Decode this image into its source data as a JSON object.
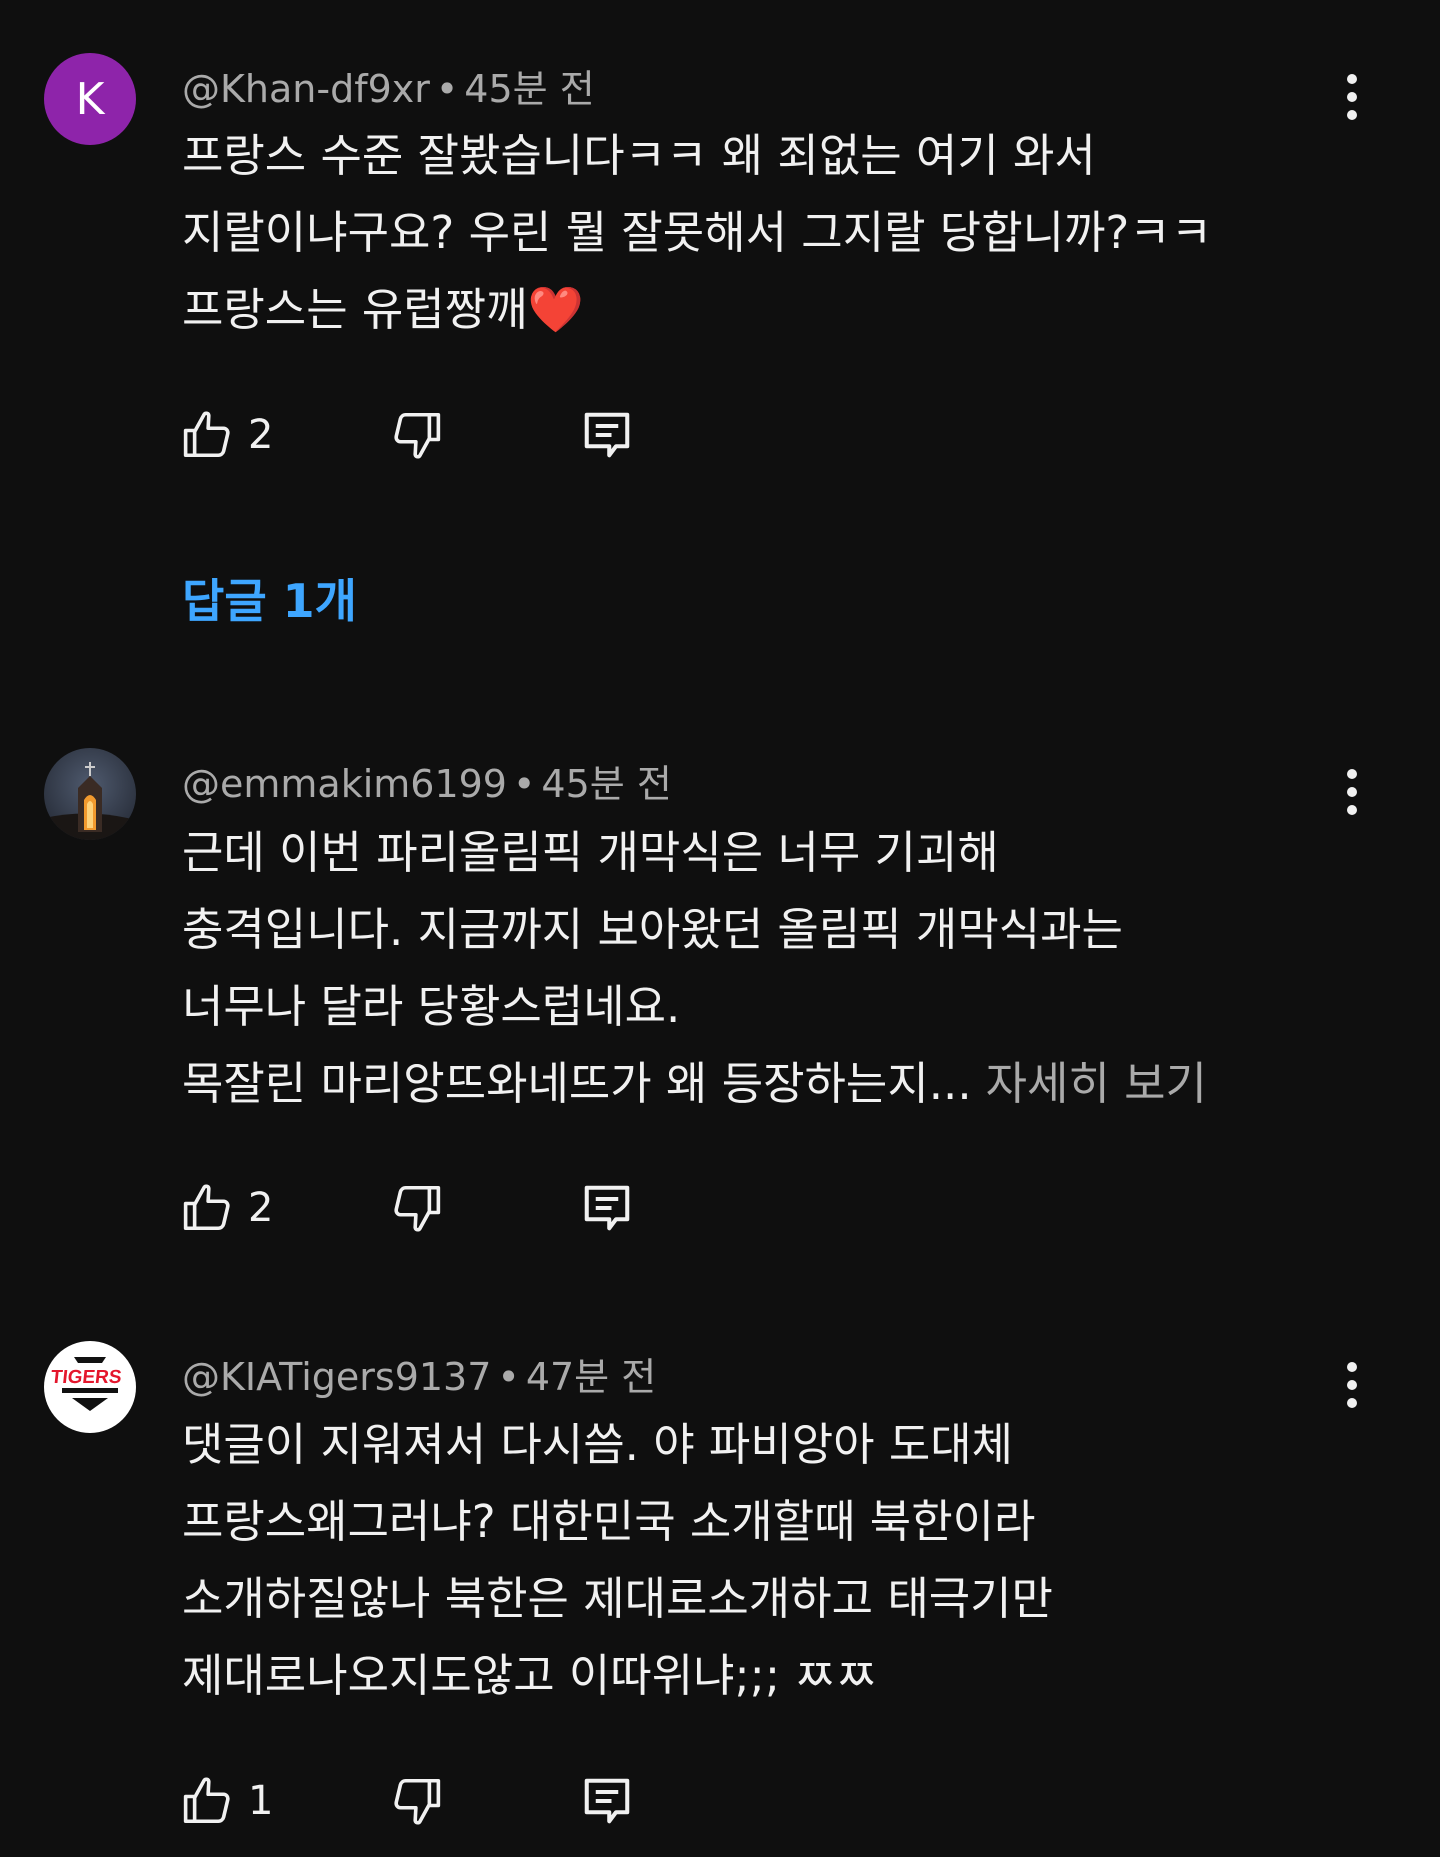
{
  "comments": [
    {
      "author": "@Khan-df9xr",
      "time": "45분 전",
      "avatar_letter": "K",
      "lines": [
        "프랑스 수준 잘봤습니다ㅋㅋ 왜 죄없는 여기 와서",
        "지랄이냐구요? 우린 뭘 잘못해서 그지랄 당합니까?ㅋㅋ",
        "프랑스는 유럽짱깨❤️"
      ],
      "likes": "2",
      "replies_label": "답글 1개"
    },
    {
      "author": "@emmakim6199",
      "time": "45분 전",
      "lines": [
        "근데 이번 파리올림픽 개막식은 너무 기괴해",
        "충격입니다. 지금까지 보아왔던 올림픽 개막식과는",
        "너무나 달라 당황스럽네요.",
        "목잘린 마리앙뜨와네뜨가 왜 등장하는지..."
      ],
      "read_more": "자세히 보기",
      "likes": "2"
    },
    {
      "author": "@KIATigers9137",
      "time": "47분 전",
      "avatar_text": "TIGERS",
      "lines": [
        "댓글이 지워져서 다시씀. 야 파비앙아 도대체",
        "프랑스왜그러냐? 대한민국 소개할때 북한이라",
        "소개하질않나 북한은 제대로소개하고 태극기만",
        "제대로나오지도않고 이따위냐;;; ㅉㅉ"
      ],
      "likes": "1"
    }
  ],
  "icons": {
    "more": "more-vert-icon",
    "like": "thumb-up-icon",
    "dislike": "thumb-down-icon",
    "reply": "reply-comment-icon"
  },
  "colors": {
    "background": "#0f0f0f",
    "text": "#f1f1f1",
    "meta": "#aaaaaa",
    "link": "#3ea6ff",
    "avatar_k": "#8e24aa",
    "tigers_red": "#e4162c"
  }
}
